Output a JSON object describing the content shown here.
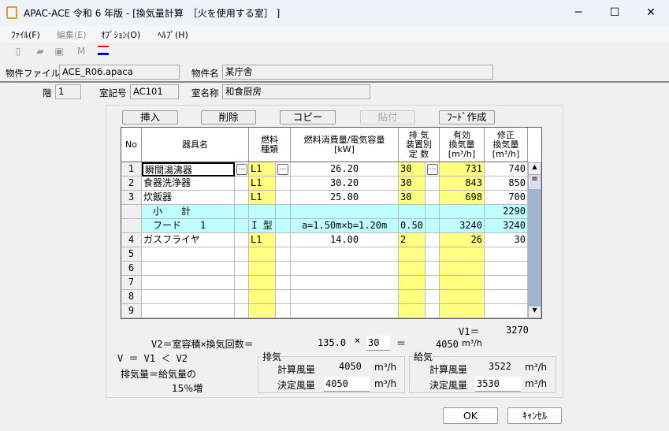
{
  "window": {
    "title": "APAC-ACE 令和 6 年版 - [換気量計算　［火を使用する室］ ]",
    "minimize": "─",
    "maximize": "☐",
    "close": "✕"
  },
  "menu": [
    {
      "label": "ﾌｧｲﾙ(F)",
      "enabled": true
    },
    {
      "label": "編集(E)",
      "enabled": false
    },
    {
      "label": "ｵﾌﾟｼｮﾝ(O)",
      "enabled": true
    },
    {
      "label": "ﾍﾙﾌﾟ(H)",
      "enabled": true
    }
  ],
  "toolbar": {
    "icons": [
      "new-file-icon",
      "open-folder-icon",
      "save-icon",
      "m-icon",
      "chart-icon"
    ]
  },
  "project": {
    "file_label": "物件ファイル名",
    "file": "ACE_R06.apaca",
    "name_label": "物件名",
    "name": "某庁舎"
  },
  "room": {
    "floor_label": "階",
    "floor": "1",
    "code_label": "室記号",
    "code": "AC101",
    "name_label": "室名称",
    "name": "和食厨房"
  },
  "buttons": {
    "insert": "挿入",
    "delete": "削除",
    "copy": "コピー",
    "paste": "貼付",
    "hood": "ﾌｰﾄﾞ作成",
    "ok": "OK",
    "cancel": "ｷｬﾝｾﾙ"
  },
  "grid": {
    "headers": [
      "No",
      "器具名",
      "燃料\n種類",
      "燃料消費量/電気容量\n[kW]",
      "排 気\n装置別\n定 数",
      "有効\n換気量\n[m³/h]",
      "修正\n換気量\n[m³/h]"
    ],
    "rows": [
      {
        "type": "item",
        "no": "1",
        "name": "瞬間湯沸器",
        "fuel": "L1",
        "consumption": "26.20",
        "constant": "30",
        "effective": "731",
        "corrected": "740"
      },
      {
        "type": "item",
        "no": "2",
        "name": "食器洗浄器",
        "fuel": "L1",
        "consumption": "30.20",
        "constant": "30",
        "effective": "843",
        "corrected": "850"
      },
      {
        "type": "item",
        "no": "3",
        "name": "炊飯器",
        "fuel": "L1",
        "consumption": "25.00",
        "constant": "30",
        "effective": "698",
        "corrected": "700"
      },
      {
        "type": "subtotal",
        "name": "　小　　計",
        "corrected": "2290"
      },
      {
        "type": "hood",
        "name": "　フード　　1",
        "fuel": "I 型",
        "consumption": "a=1.50m×b=1.20m",
        "constant": "0.50",
        "effective": "3240",
        "corrected": "3240"
      },
      {
        "type": "item",
        "no": "4",
        "name": "ガスフライヤ",
        "fuel": "L1",
        "consumption": "14.00",
        "constant": "2",
        "effective": "26",
        "corrected": "30"
      },
      {
        "type": "empty",
        "no": "5"
      },
      {
        "type": "empty",
        "no": "6"
      },
      {
        "type": "empty",
        "no": "7"
      },
      {
        "type": "empty",
        "no": "8"
      },
      {
        "type": "empty",
        "no": "9"
      }
    ]
  },
  "calc": {
    "v1_label": "V1＝",
    "v1": "3270",
    "v2_label": "V2＝室容積×換気回数＝",
    "volume": "135.0",
    "times": "×",
    "air_changes": "30",
    "equals": "＝",
    "v2": "4050",
    "unit": "m³/h",
    "relation": "V ＝ V1 ＜ V2",
    "note1": "排気量＝給気量の",
    "note2": "15％増"
  },
  "exhaust": {
    "title": "排気",
    "calc_label": "計算風量",
    "calc": "4050",
    "decided_label": "決定風量",
    "decided": "4050",
    "unit": "m³/h"
  },
  "supply": {
    "title": "給気",
    "calc_label": "計算風量",
    "calc": "3522",
    "decided_label": "決定風量",
    "decided": "3530",
    "unit": "m³/h"
  }
}
